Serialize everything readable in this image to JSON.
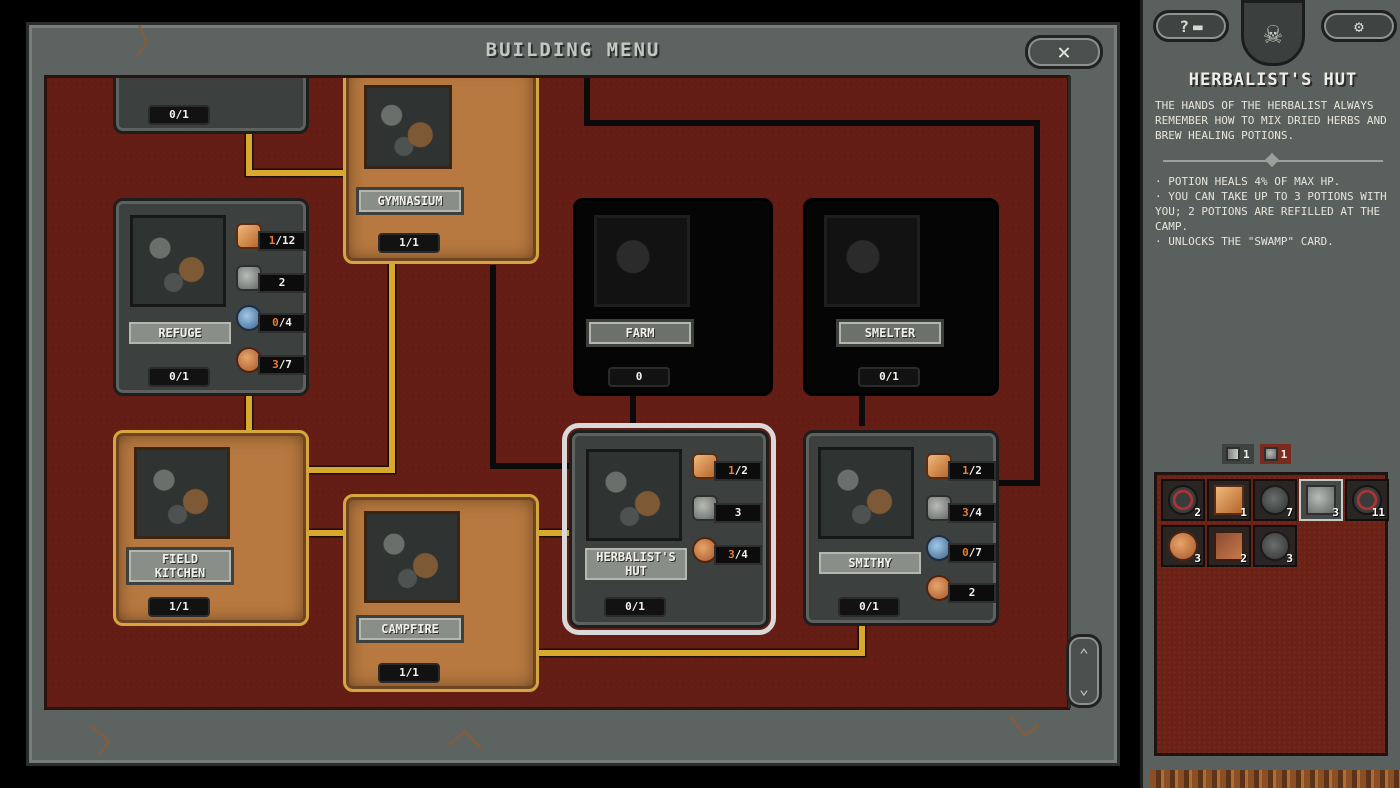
{
  "window": {
    "title": "BUILDING MENU",
    "close_label": "✕"
  },
  "buildings": {
    "top_left": {
      "count": "0/1"
    },
    "gymnasium": {
      "name": "GYMNASIUM",
      "count": "1/1"
    },
    "refuge": {
      "name": "REFUGE",
      "count": "0/1",
      "resources": [
        {
          "icon": "wood-plank-icon",
          "hl": "1",
          "rest": "/12"
        },
        {
          "icon": "stone-block-icon",
          "hl": "",
          "rest": "2"
        },
        {
          "icon": "orb-of-expansion-icon",
          "hl": "0",
          "rest": "/4"
        },
        {
          "icon": "food-supply-icon",
          "hl": "3",
          "rest": "/7"
        }
      ]
    },
    "farm": {
      "name": "FARM",
      "count": "0"
    },
    "smelter": {
      "name": "SMELTER",
      "count": "0/1"
    },
    "field_kitchen": {
      "name": "FIELD KITCHEN",
      "count": "1/1"
    },
    "campfire": {
      "name": "CAMPFIRE",
      "count": "1/1"
    },
    "herbalists_hut": {
      "name": "HERBALIST'S HUT",
      "count": "0/1",
      "resources": [
        {
          "icon": "wood-plank-icon",
          "hl": "1",
          "rest": "/2"
        },
        {
          "icon": "stone-block-icon",
          "hl": "",
          "rest": "3"
        },
        {
          "icon": "food-supply-icon",
          "hl": "3",
          "rest": "/4"
        }
      ]
    },
    "smithy": {
      "name": "SMITHY",
      "count": "0/1",
      "resources": [
        {
          "icon": "wood-plank-icon",
          "hl": "1",
          "rest": "/2"
        },
        {
          "icon": "stone-block-icon",
          "hl": "3",
          "rest": "/4"
        },
        {
          "icon": "orb-of-expansion-icon",
          "hl": "0",
          "rest": "/7"
        },
        {
          "icon": "food-supply-icon",
          "hl": "",
          "rest": "2"
        }
      ]
    }
  },
  "side_panel": {
    "help_label": "?",
    "settings_label": "⚙",
    "title": "HERBALIST'S HUT",
    "description": "THE HANDS OF THE HERBALIST ALWAYS REMEMBER HOW TO MIX DRIED HERBS AND BREW HEALING POTIONS.",
    "effects": [
      "· POTION HEALS 4% OF MAX HP.",
      "· YOU CAN TAKE UP TO 3 POTIONS WITH YOU; 2 POTIONS ARE REFILLED AT THE CAMP.",
      "· UNLOCKS THE \"SWAMP\" CARD."
    ],
    "inventory_tags": [
      {
        "icon": "shovel-icon",
        "count": "1"
      },
      {
        "icon": "grid-card-icon",
        "count": "1"
      }
    ],
    "inventory": [
      {
        "icon": "rune-icon",
        "count": "2"
      },
      {
        "icon": "wood-plank-icon",
        "count": "1"
      },
      {
        "icon": "shell-icon",
        "count": "7"
      },
      {
        "icon": "stone-block-icon",
        "count": "3"
      },
      {
        "icon": "rune-icon",
        "count": "11"
      },
      {
        "icon": "food-supply-icon",
        "count": "3"
      },
      {
        "icon": "book-icon",
        "count": "2"
      },
      {
        "icon": "shell-icon",
        "count": "3"
      }
    ]
  },
  "scroll": {
    "up": "⌃",
    "down": "⌄"
  },
  "colors": {
    "tree_background": "#631d15",
    "built_border": "#d5a53e",
    "connection_line": "#d9a92e",
    "resource_highlight": "#f07a2e"
  }
}
